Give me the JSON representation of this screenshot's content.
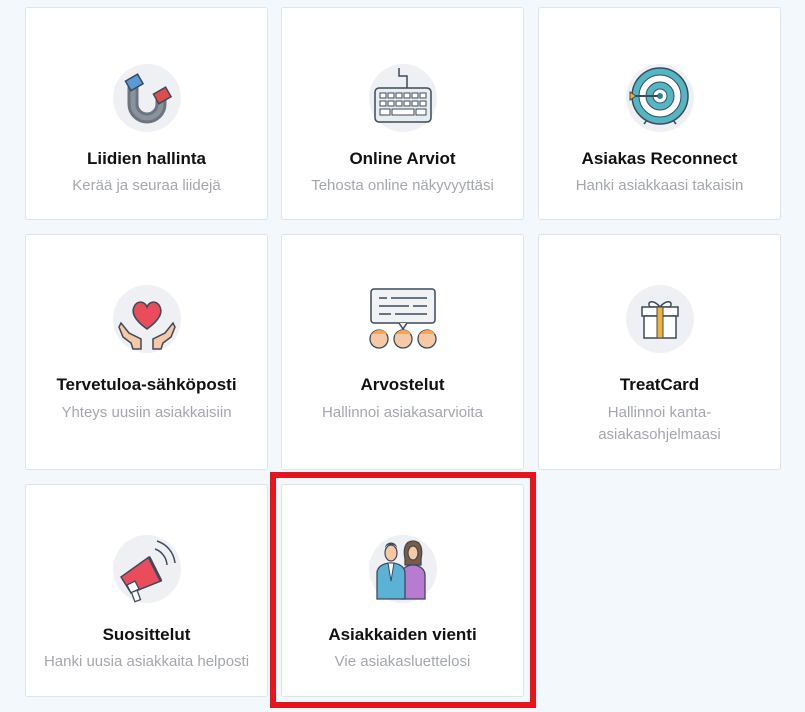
{
  "cards": [
    {
      "title": "Liidien hallinta",
      "desc": "Kerää ja seuraa liidejä",
      "icon": "magnet-icon"
    },
    {
      "title": "Online Arviot",
      "desc": "Tehosta online näkyvyyttäsi",
      "icon": "keyboard-icon"
    },
    {
      "title": "Asiakas Reconnect",
      "desc": "Hanki asiakkaasi takaisin",
      "icon": "target-icon"
    },
    {
      "title": "Tervetuloa-sähköposti",
      "desc": "Yhteys uusiin asiakkaisiin",
      "icon": "heart-hands-icon"
    },
    {
      "title": "Arvostelut",
      "desc": "Hallinnoi asiakasarvioita",
      "icon": "review-board-icon"
    },
    {
      "title": "TreatCard",
      "desc": "Hallinnoi kanta-asiakasohjelmaasi",
      "icon": "gift-icon"
    },
    {
      "title": "Suosittelut",
      "desc": "Hanki uusia asiakkaita helposti",
      "icon": "megaphone-icon"
    },
    {
      "title": "Asiakkaiden vienti",
      "desc": "Vie asiakasluettelosi",
      "icon": "people-icon"
    }
  ],
  "colors": {
    "background": "#f3f8fd",
    "highlight": "#e8141c",
    "title": "#111111",
    "description": "#a3a7ad"
  }
}
